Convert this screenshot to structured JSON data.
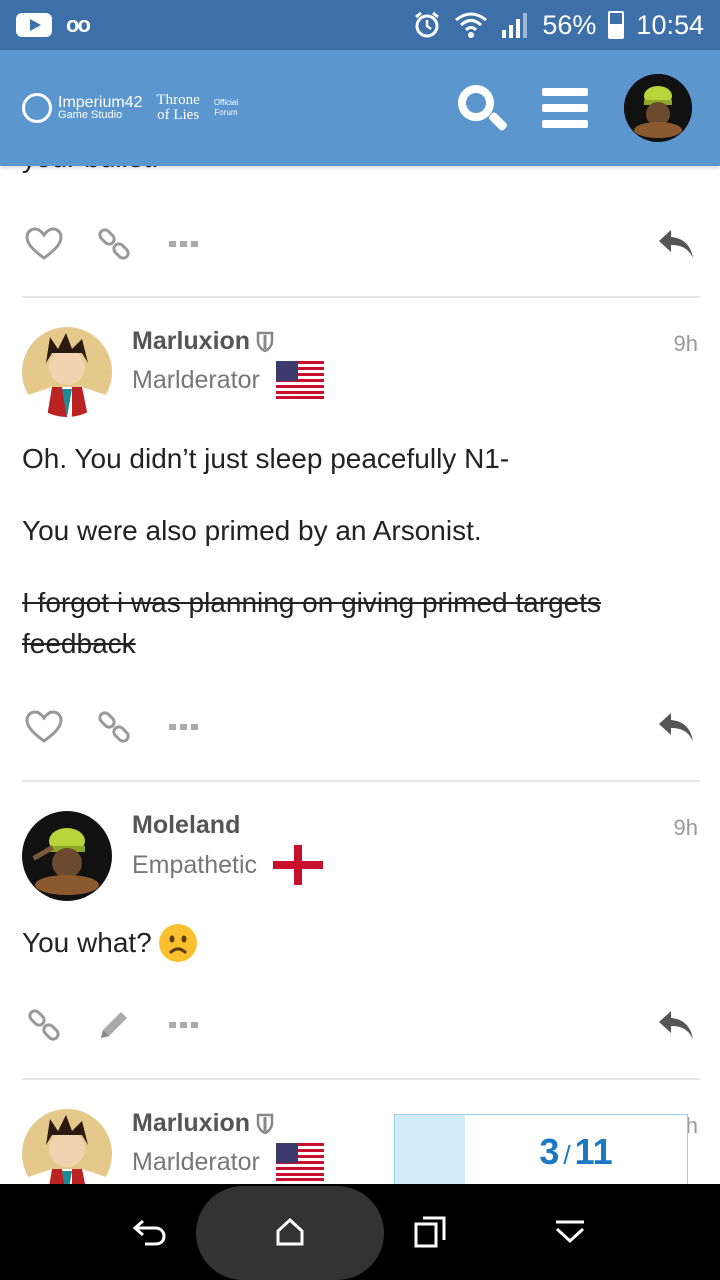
{
  "status_bar": {
    "battery": "56%",
    "battery_level": 0.56,
    "time": "10:54",
    "voicemail": "oo"
  },
  "header": {
    "brand_line1": "Imperium42",
    "brand_line2": "Game Studio",
    "game_line1": "Throne",
    "game_line2": "of Lies",
    "forum_line1": "Official",
    "forum_line2": "Forum",
    "accent": "#5b96cf"
  },
  "partial_post": {
    "text": "your bullet."
  },
  "posts": [
    {
      "username": "Marluxion",
      "user_title": "Marlderator",
      "time": "9h",
      "flag": "us-flag",
      "paragraphs": [
        "Oh. You didn’t just sleep peacefully N1-",
        "You were also primed by an Arsonist."
      ],
      "struck_line1": "I forgot i was planning on giving primed targets",
      "struck_line2": "feedback"
    },
    {
      "username": "Moleland",
      "user_title": "Empathetic",
      "time": "9h",
      "flag": "england-flag",
      "paragraphs": [
        "You what?"
      ],
      "emoji": "frowning-face"
    },
    {
      "username": "Marluxion",
      "user_title": "Marlderator",
      "time": "h",
      "flag": "us-flag"
    }
  ],
  "progress": {
    "current": "3",
    "separator": "/",
    "total": "11"
  }
}
